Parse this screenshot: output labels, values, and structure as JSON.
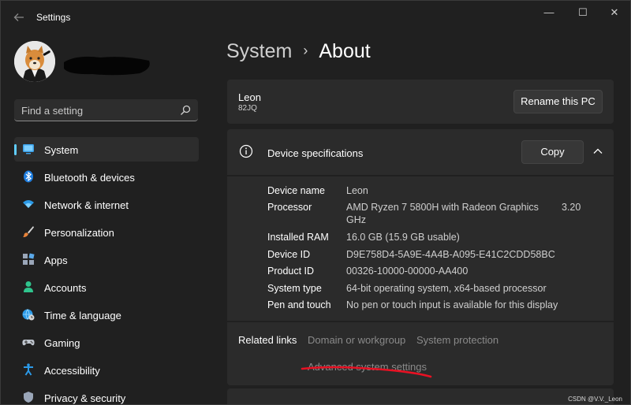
{
  "window": {
    "title": "Settings",
    "back_icon": "arrow-left-icon",
    "controls": {
      "minimize": "—",
      "maximize": "☐",
      "close": "✕"
    }
  },
  "search": {
    "placeholder": "Find a setting",
    "icon": "search-icon"
  },
  "sidebar": {
    "items": [
      {
        "label": "System",
        "icon": "monitor-icon",
        "active": true
      },
      {
        "label": "Bluetooth & devices",
        "icon": "bluetooth-icon"
      },
      {
        "label": "Network & internet",
        "icon": "wifi-icon"
      },
      {
        "label": "Personalization",
        "icon": "brush-icon"
      },
      {
        "label": "Apps",
        "icon": "apps-icon"
      },
      {
        "label": "Accounts",
        "icon": "person-icon"
      },
      {
        "label": "Time & language",
        "icon": "globe-clock-icon"
      },
      {
        "label": "Gaming",
        "icon": "gamepad-icon"
      },
      {
        "label": "Accessibility",
        "icon": "accessibility-icon"
      },
      {
        "label": "Privacy & security",
        "icon": "shield-icon"
      }
    ]
  },
  "breadcrumb": {
    "parent": "System",
    "separator": "›",
    "current": "About"
  },
  "pc": {
    "name": "Leon",
    "model": "82JQ",
    "rename_label": "Rename this PC"
  },
  "device_specs": {
    "title": "Device specifications",
    "copy_label": "Copy",
    "rows": [
      {
        "label": "Device name",
        "value": "Leon"
      },
      {
        "label": "Processor",
        "value_line1": "AMD Ryzen 7 5800H with Radeon Graphics",
        "value_speed": "3.20",
        "value_line2": "GHz"
      },
      {
        "label": "Installed RAM",
        "value": "16.0 GB (15.9 GB usable)"
      },
      {
        "label": "Device ID",
        "value": "D9E758D4-5A9E-4A4B-A095-E41C2CDD58BC"
      },
      {
        "label": "Product ID",
        "value": "00326-10000-00000-AA400"
      },
      {
        "label": "System type",
        "value": "64-bit operating system, x64-based processor"
      },
      {
        "label": "Pen and touch",
        "value": "No pen or touch input is available for this display"
      }
    ]
  },
  "related_links": {
    "title": "Related links",
    "links": [
      "Domain or workgroup",
      "System protection",
      "Advanced system settings"
    ]
  },
  "watermark": "CSDN @V.V._Leon",
  "colors": {
    "background": "#202020",
    "card": "#2b2b2b",
    "accent": "#60cdff",
    "annotation": "#e81123"
  }
}
